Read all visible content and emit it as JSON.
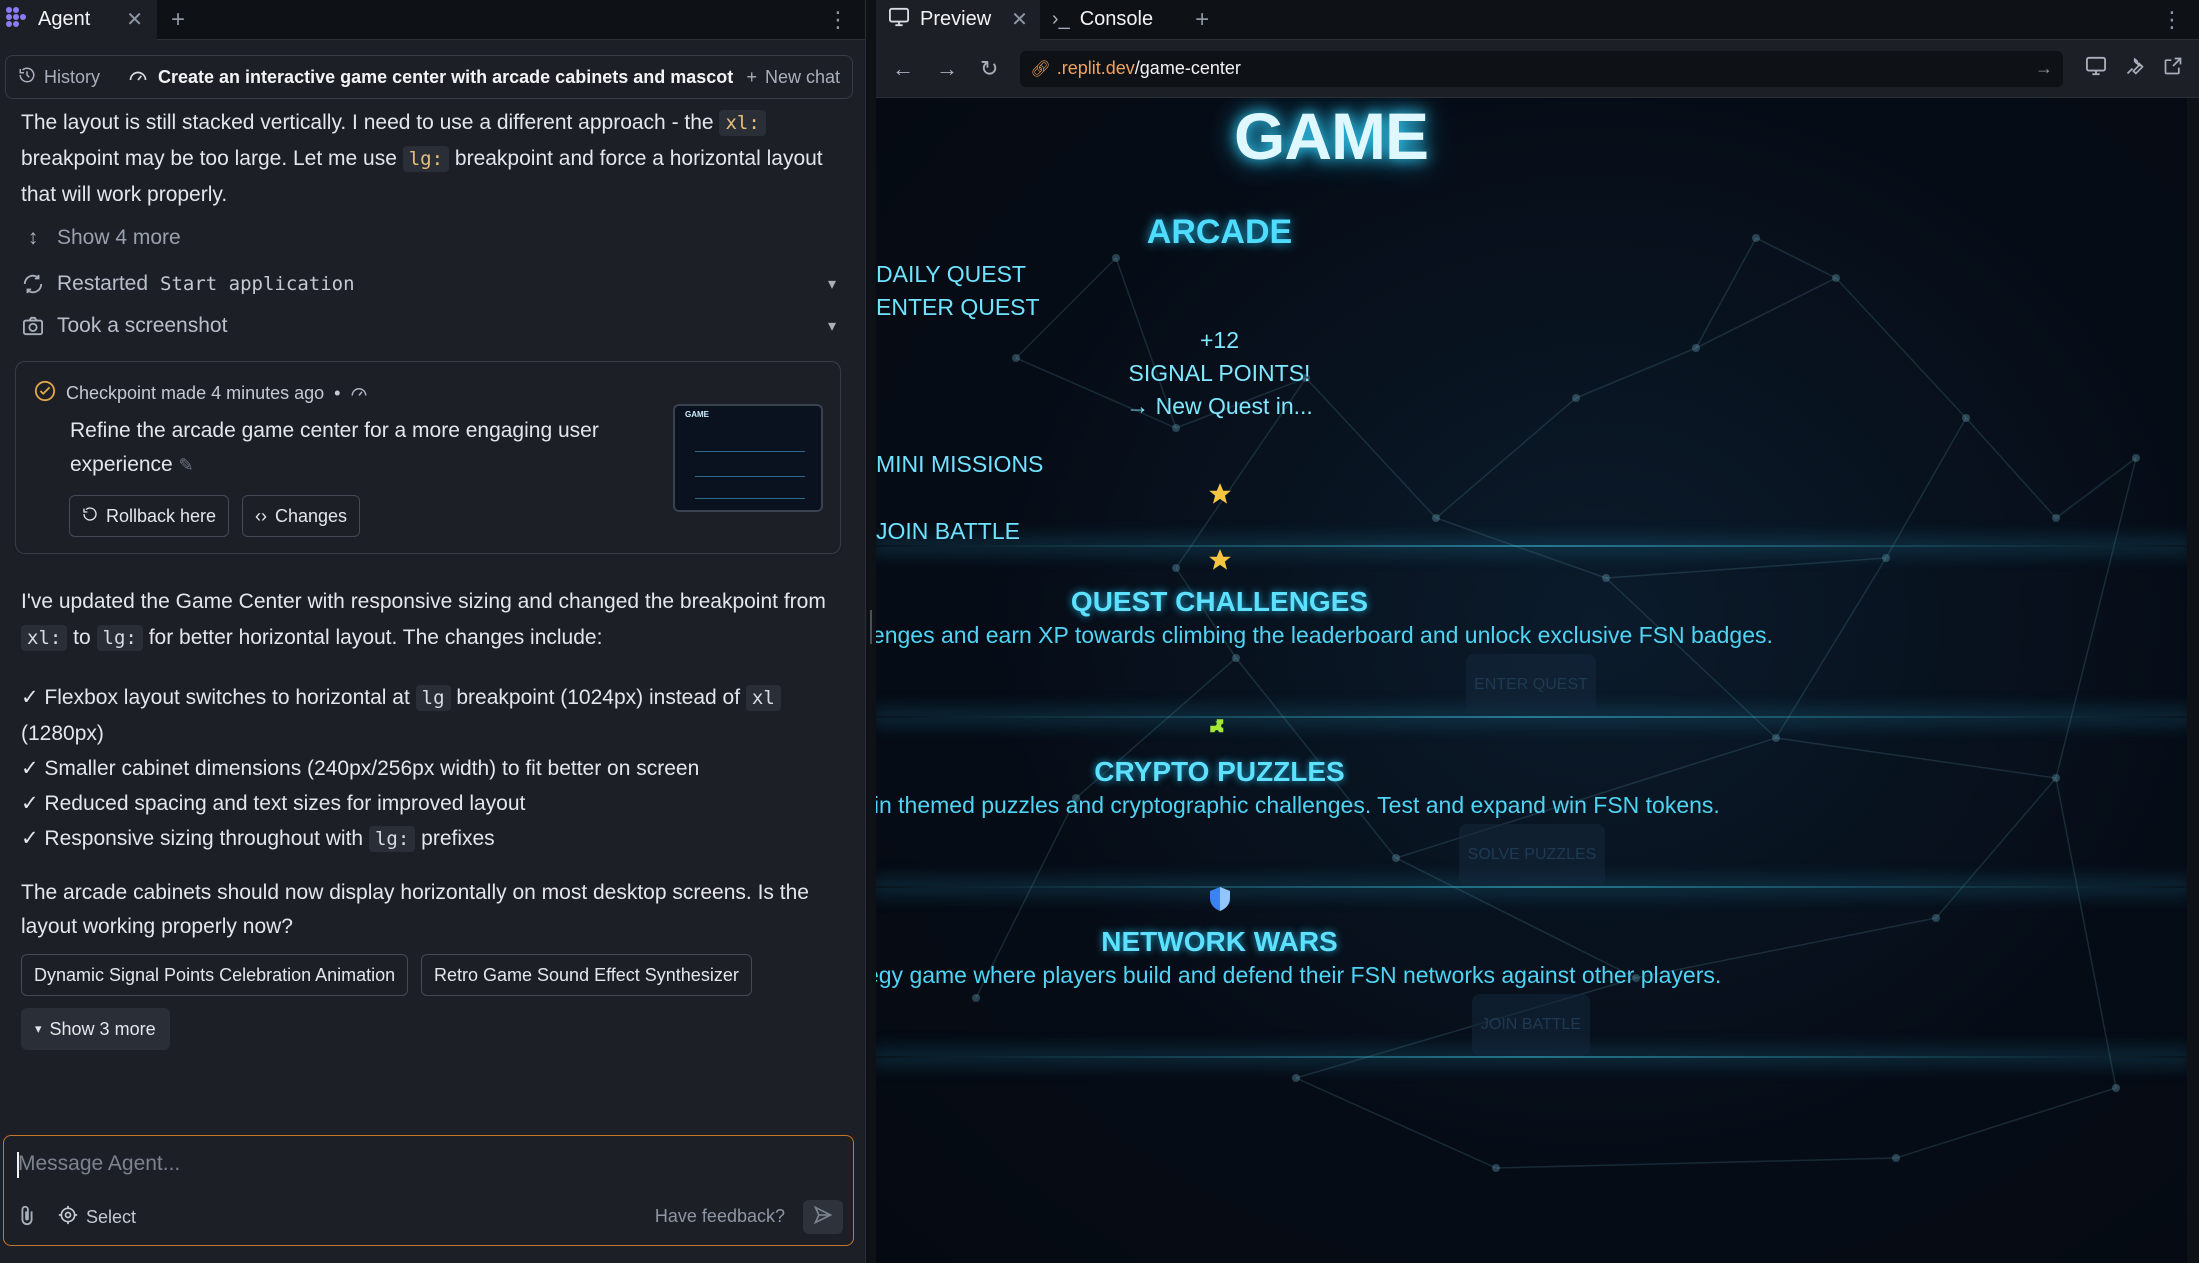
{
  "left": {
    "tab_label": "Agent",
    "history_label": "History",
    "chat_title": "Create an interactive game center with arcade cabinets and mascot",
    "new_chat_label": "New chat",
    "msg1_a": "The layout is still stacked vertically. I need to use a different approach - the",
    "msg1_code1": "xl:",
    "msg1_b": "breakpoint may be too large. Let me use",
    "msg1_code2": "lg:",
    "msg1_c": "breakpoint and force a horizontal layout that will work properly.",
    "show4": "Show 4 more",
    "restarted_prefix": "Restarted",
    "restarted_cmd": "Start application",
    "screenshot": "Took a screenshot",
    "checkpoint": {
      "head": "Checkpoint made 4 minutes ago",
      "sep": "•",
      "body": "Refine the arcade game center for a more engaging user experience",
      "rollback": "Rollback here",
      "changes": "Changes",
      "thumb_title": "GAME"
    },
    "msg2_a": "I've updated the Game Center with responsive sizing and changed the breakpoint from",
    "msg2_code1": "xl:",
    "msg2_to": "to",
    "msg2_code2": "lg:",
    "msg2_b": "for better horizontal layout. The changes include:",
    "bullets": {
      "b1_a": "✓ Flexbox layout switches to horizontal at",
      "b1_code1": "lg",
      "b1_b": "breakpoint (1024px) instead of",
      "b1_code2": "xl",
      "b1_c": "(1280px)",
      "b2": "✓ Smaller cabinet dimensions (240px/256px width) to fit better on screen",
      "b3": "✓ Reduced spacing and text sizes for improved layout",
      "b4_a": "✓ Responsive sizing throughout with",
      "b4_code": "lg:",
      "b4_b": "prefixes"
    },
    "msg3": "The arcade cabinets should now display horizontally on most desktop screens. Is the layout working properly now?",
    "suggest1": "Dynamic Signal Points Celebration Animation",
    "suggest2": "Retro Game Sound Effect Synthesizer",
    "show3": "Show 3 more",
    "composer_placeholder": "Message Agent...",
    "select_label": "Select",
    "feedback_label": "Have feedback?"
  },
  "right": {
    "tab_preview": "Preview",
    "tab_console": "Console",
    "url_domain": ".replit.dev",
    "url_path": "/game-center",
    "game": {
      "title": "GAME",
      "arcade": "ARCADE",
      "daily_quest": "DAILY QUEST",
      "enter_quest": "ENTER QUEST",
      "points_a": "+12",
      "points_b": "SIGNAL POINTS!",
      "points_c": "→ New Quest in...",
      "mini_missions": "MINI MISSIONS",
      "join_battle": "JOIN BATTLE",
      "sections": [
        {
          "title": "QUEST CHALLENGES",
          "desc": "Complete daily challenges and earn XP towards climbing the leaderboard and unlock exclusive FSN badges.",
          "button": "ENTER QUEST"
        },
        {
          "title": "CRYPTO PUZZLES",
          "desc": "Solve blockchain themed puzzles and cryptographic challenges. Test and expand win FSN tokens.",
          "button": "SOLVE PUZZLES"
        },
        {
          "title": "NETWORK WARS",
          "desc": "Real time strategy game where players build and defend their FSN networks against other players.",
          "button": "JOIN BATTLE"
        }
      ]
    }
  },
  "colors": {
    "accent_orange": "#c4762b",
    "neon_cyan": "#4fdcff",
    "url_domain": "#f0a35e"
  }
}
